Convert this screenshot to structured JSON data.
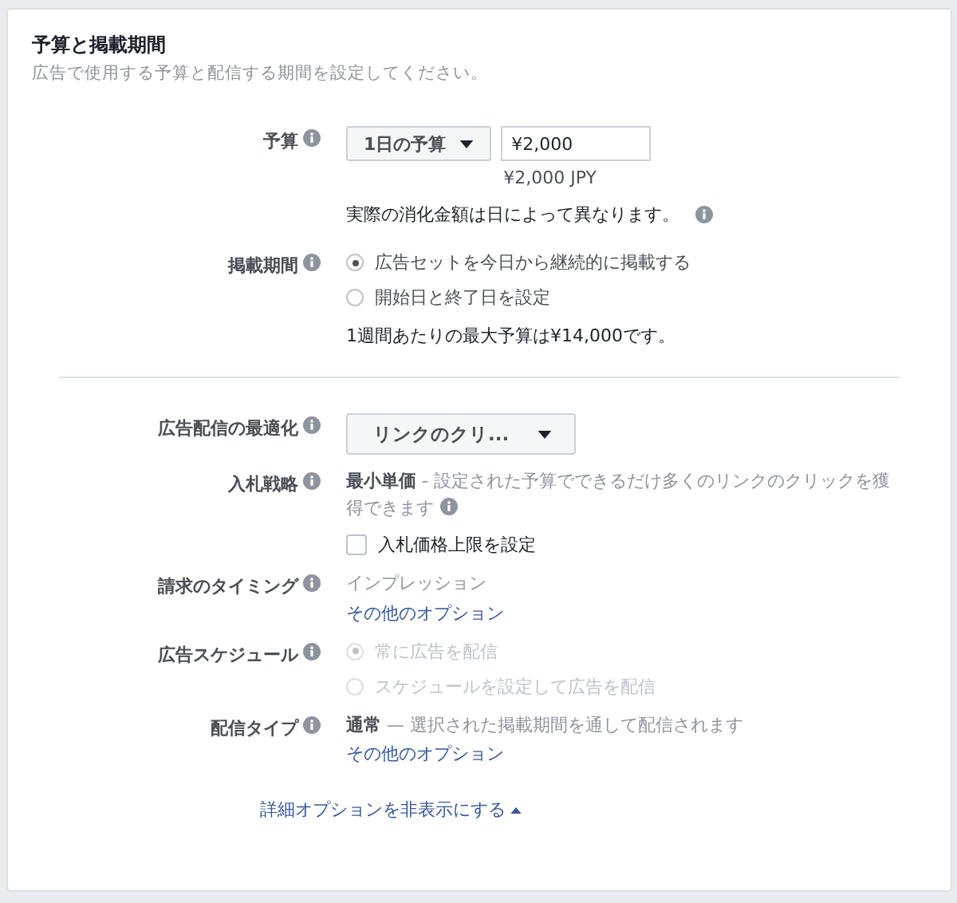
{
  "header": {
    "title": "予算と掲載期間",
    "subtitle": "広告で使用する予算と配信する期間を設定してください。"
  },
  "sections": [
    {
      "rows": [
        {
          "kind": "budget",
          "label": "予算",
          "dropdown": "1日の予算",
          "amount": "¥2,000",
          "currency_note": "¥2,000 JPY",
          "note": "実際の消化金額は日によって異なります。",
          "note_info": true
        },
        {
          "kind": "radios",
          "label": "掲載期間",
          "disabled": false,
          "options": [
            {
              "label": "広告セットを今日から継続的に掲載する",
              "selected": true
            },
            {
              "label": "開始日と終了日を設定",
              "selected": false
            }
          ],
          "note": "1週間あたりの最大予算は¥14,000です。"
        }
      ]
    },
    {
      "rows": [
        {
          "kind": "dropdown",
          "label": "広告配信の最適化",
          "dropdown": "リンクのクリ..."
        },
        {
          "kind": "text",
          "label": "入札戦略",
          "value": "**最小単価** - 設定された予算でできるだけ多くのリンクのクリックを獲得できます",
          "value_info": true,
          "checkbox": {
            "label": "入札価格上限を設定",
            "checked": false
          }
        },
        {
          "kind": "text",
          "label": "請求のタイミング",
          "value": "インプレッション",
          "link": "その他のオプション"
        },
        {
          "kind": "radios",
          "label": "広告スケジュール",
          "disabled": true,
          "options": [
            {
              "label": "常に広告を配信",
              "selected": true
            },
            {
              "label": "スケジュールを設定して広告を配信",
              "selected": false
            }
          ]
        },
        {
          "kind": "text",
          "label": "配信タイプ",
          "value": "**通常** — 選択された掲載期間を通して配信されます",
          "link": "その他のオプション"
        }
      ]
    }
  ],
  "footer_link": "詳細オプションを非表示にする"
}
